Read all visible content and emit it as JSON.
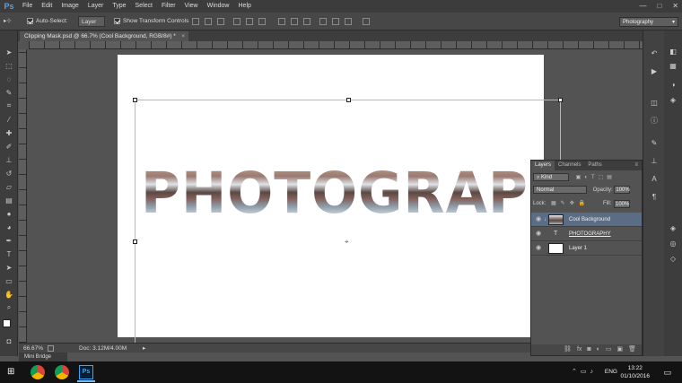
{
  "app": {
    "logo": "Ps"
  },
  "menubar": {
    "items": [
      "File",
      "Edit",
      "Image",
      "Layer",
      "Type",
      "Select",
      "Filter",
      "View",
      "Window",
      "Help"
    ],
    "window_controls": [
      "—",
      "□",
      "✕"
    ]
  },
  "options": {
    "auto_select_label": "Auto-Select:",
    "auto_select_target": "Layer",
    "show_transform_label": "Show Transform Controls",
    "workspace": "Photography"
  },
  "document": {
    "tab_title": "Clipping Mask.psd @ 66.7% (Cool Background, RGB/8#) *",
    "tab_close": "×",
    "canvas_text": "PHOTOGRAPHY"
  },
  "status": {
    "zoom": "66.67%",
    "doc_info": "Doc: 3.12M/4.00M",
    "mini_bridge": "Mini Bridge"
  },
  "layers_panel": {
    "tabs": [
      "Layers",
      "Channels",
      "Paths"
    ],
    "active_tab": "Layers",
    "kind_filter": "Kind",
    "blend_mode": "Normal",
    "opacity_label": "Opacity:",
    "opacity_value": "100%",
    "lock_label": "Lock:",
    "fill_label": "Fill:",
    "fill_value": "100%",
    "layers": [
      {
        "name": "Cool Background",
        "type": "image",
        "clipped": true,
        "selected": true
      },
      {
        "name": "PHOTOGRAPHY",
        "type": "text",
        "clipped": false,
        "selected": false
      },
      {
        "name": "Layer 1",
        "type": "fill",
        "clipped": false,
        "selected": false
      }
    ]
  },
  "taskbar": {
    "language": "ENG",
    "time": "13:22",
    "date": "01/10/2016"
  },
  "colors": {
    "menubar": "#3c3c3c",
    "panel": "#535353",
    "selected_layer": "#5b6d84",
    "foreground_swatch": "#ffffff",
    "background_swatch": "#7a1577"
  }
}
